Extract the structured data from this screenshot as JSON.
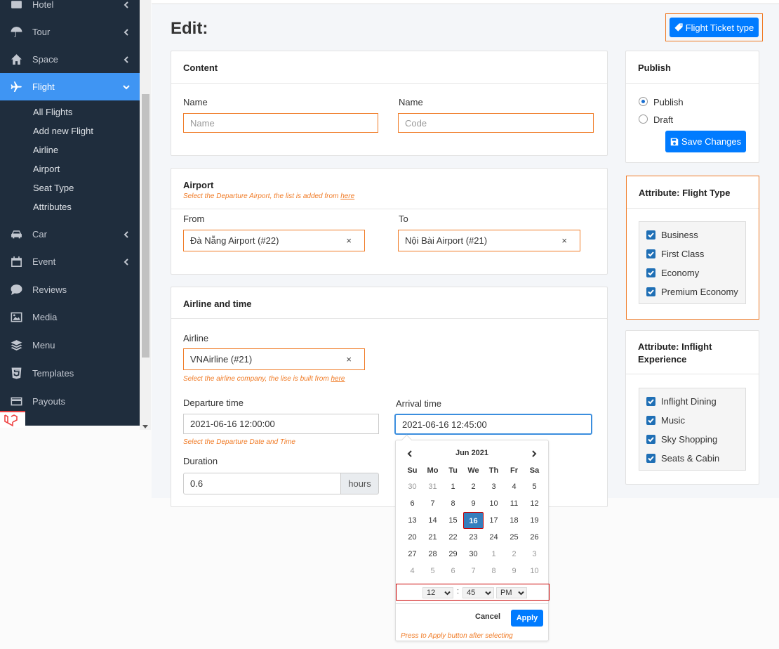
{
  "sidebar": {
    "items": [
      {
        "label": "Hotel",
        "icon": "hotel-icon"
      },
      {
        "label": "Tour",
        "icon": "umbrella-icon"
      },
      {
        "label": "Space",
        "icon": "home-icon"
      },
      {
        "label": "Flight",
        "icon": "plane-icon"
      },
      {
        "label": "Car",
        "icon": "car-icon"
      },
      {
        "label": "Event",
        "icon": "calendar-icon"
      },
      {
        "label": "Reviews",
        "icon": "comment-icon"
      },
      {
        "label": "Media",
        "icon": "image-icon"
      },
      {
        "label": "Menu",
        "icon": "layers-icon"
      },
      {
        "label": "Templates",
        "icon": "html5-icon"
      },
      {
        "label": "Payouts",
        "icon": "credit-card-icon"
      }
    ],
    "flight_sub": [
      "All Flights",
      "Add new Flight",
      "Airline",
      "Airport",
      "Seat Type",
      "Attributes"
    ]
  },
  "page": {
    "title": "Edit:",
    "ticket_type_button": "Flight Ticket type"
  },
  "content_card": {
    "title": "Content",
    "name_label": "Name",
    "name_placeholder": "Name",
    "code_label": "Name",
    "code_placeholder": "Code"
  },
  "airport_card": {
    "title": "Airport",
    "hint": "Select the Departure Airport, the list is added from ",
    "hint_link": "here",
    "from_label": "From",
    "from_value": "Đà Nẵng Airport (#22)",
    "to_label": "To",
    "to_value": "Nội Bài Airport (#21)",
    "clear": "×"
  },
  "airline_card": {
    "title": "Airline and time",
    "airline_label": "Airline",
    "airline_value": "VNAirline (#21)",
    "airline_hint": "Select the airline company, the lise is built from ",
    "airline_hint_link": "here",
    "departure_label": "Departure time",
    "departure_value": "2021-06-16 12:00:00",
    "departure_hint": "Select the Departure  Date and Time",
    "arrival_label": "Arrival time",
    "arrival_value": "2021-06-16 12:45:00",
    "duration_label": "Duration",
    "duration_value": "0.6",
    "duration_unit": "hours"
  },
  "publish_card": {
    "title": "Publish",
    "options": [
      "Publish",
      "Draft"
    ],
    "selected": "Publish",
    "save_button": "Save Changes"
  },
  "flight_type_card": {
    "title": "Attribute: Flight Type",
    "items": [
      "Business",
      "First Class",
      "Economy",
      "Premium Economy"
    ]
  },
  "inflight_card": {
    "title_line1": "Attribute: Inflight",
    "title_line2": "Experience",
    "items": [
      "Inflight Dining",
      "Music",
      "Sky Shopping",
      "Seats & Cabin"
    ]
  },
  "datepicker": {
    "month": "Jun 2021",
    "weekdays": [
      "Su",
      "Mo",
      "Tu",
      "We",
      "Th",
      "Fr",
      "Sa"
    ],
    "weeks": [
      [
        [
          "30",
          1
        ],
        [
          "31",
          1
        ],
        [
          "1",
          0
        ],
        [
          "2",
          0
        ],
        [
          "3",
          0
        ],
        [
          "4",
          0
        ],
        [
          "5",
          0
        ]
      ],
      [
        [
          "6",
          0
        ],
        [
          "7",
          0
        ],
        [
          "8",
          0
        ],
        [
          "9",
          0
        ],
        [
          "10",
          0
        ],
        [
          "11",
          0
        ],
        [
          "12",
          0
        ]
      ],
      [
        [
          "13",
          0
        ],
        [
          "14",
          0
        ],
        [
          "15",
          0
        ],
        [
          "16",
          2
        ],
        [
          "17",
          0
        ],
        [
          "18",
          0
        ],
        [
          "19",
          0
        ]
      ],
      [
        [
          "20",
          0
        ],
        [
          "21",
          0
        ],
        [
          "22",
          0
        ],
        [
          "23",
          0
        ],
        [
          "24",
          0
        ],
        [
          "25",
          0
        ],
        [
          "26",
          0
        ]
      ],
      [
        [
          "27",
          0
        ],
        [
          "28",
          0
        ],
        [
          "29",
          0
        ],
        [
          "30",
          0
        ],
        [
          "1",
          1
        ],
        [
          "2",
          1
        ],
        [
          "3",
          1
        ]
      ],
      [
        [
          "4",
          1
        ],
        [
          "5",
          1
        ],
        [
          "6",
          1
        ],
        [
          "7",
          1
        ],
        [
          "8",
          1
        ],
        [
          "9",
          1
        ],
        [
          "10",
          1
        ]
      ]
    ],
    "hour": "12",
    "minute": "45",
    "ampm": "PM",
    "separator": ":",
    "cancel": "Cancel",
    "apply": "Apply",
    "hint": "Press to Apply button after selecting"
  },
  "colors": {
    "accent": "#3f95f3",
    "sidebar": "#1f2d3d",
    "highlight": "#f07b26"
  }
}
